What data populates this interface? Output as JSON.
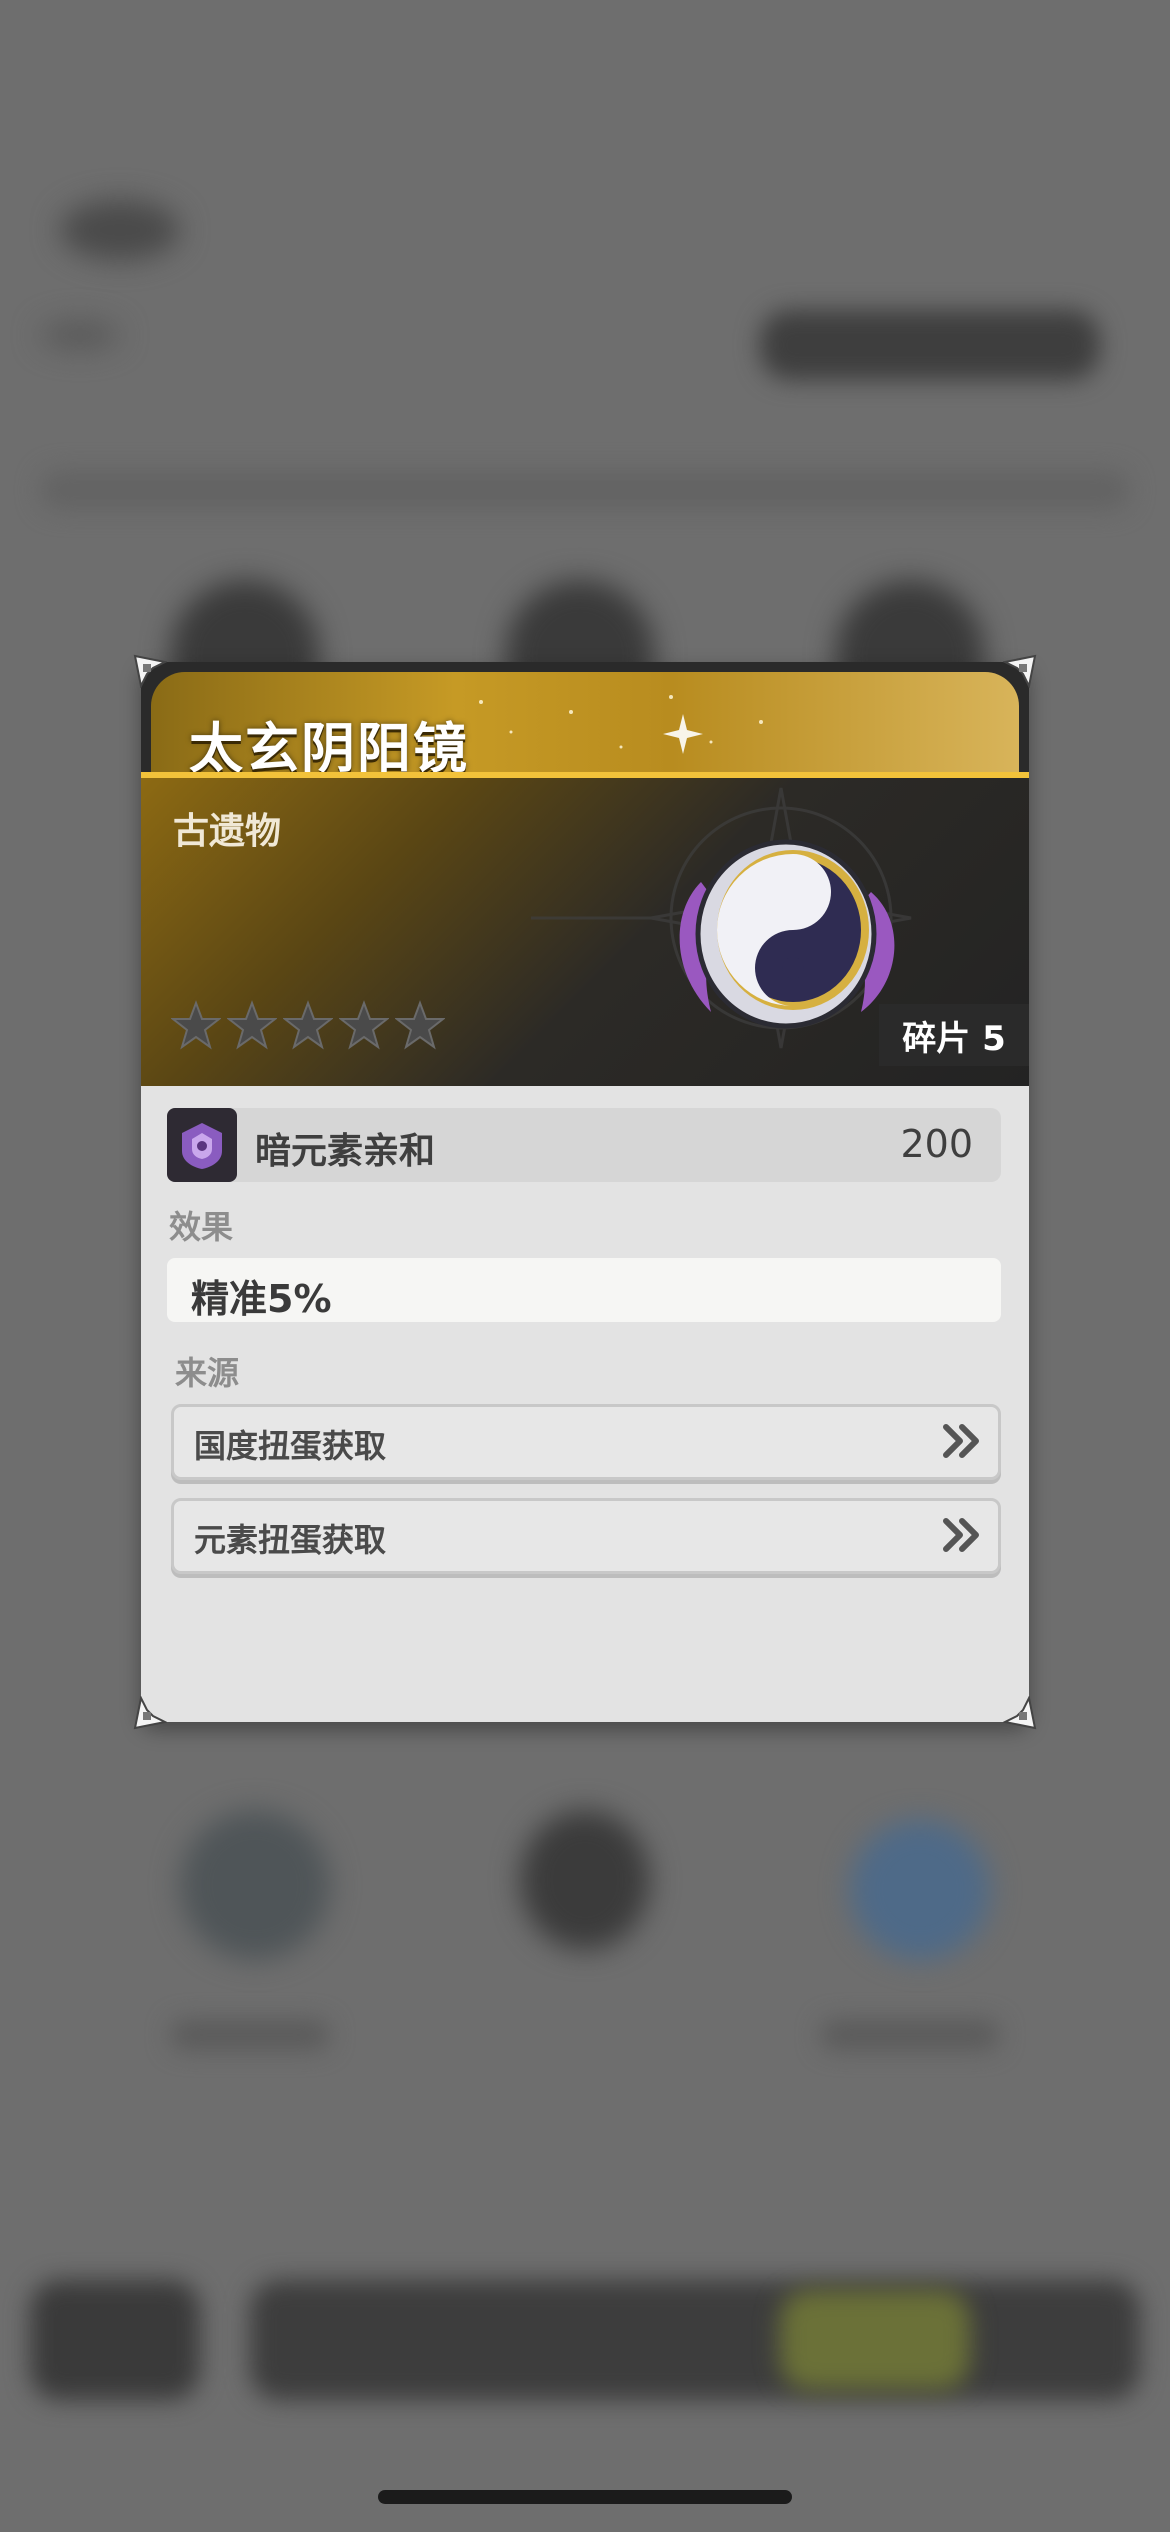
{
  "item": {
    "name": "太玄阴阳镜",
    "category": "古遗物",
    "star_total": 5,
    "star_filled": 0,
    "fragments_label": "碎片 5"
  },
  "element": {
    "name": "暗元素亲和",
    "value": "200",
    "icon": "dark-element-icon",
    "color": "#8a5cc0"
  },
  "effect": {
    "label": "效果",
    "text": "精准5%"
  },
  "source": {
    "label": "来源",
    "items": [
      {
        "label": "国度扭蛋获取",
        "icon": "double-chevron-right-icon"
      },
      {
        "label": "元素扭蛋获取",
        "icon": "double-chevron-right-icon"
      }
    ]
  },
  "colors": {
    "gold": "#f2c23a",
    "panel": "#e3e3e3",
    "overlay": "#6e6e6e"
  }
}
